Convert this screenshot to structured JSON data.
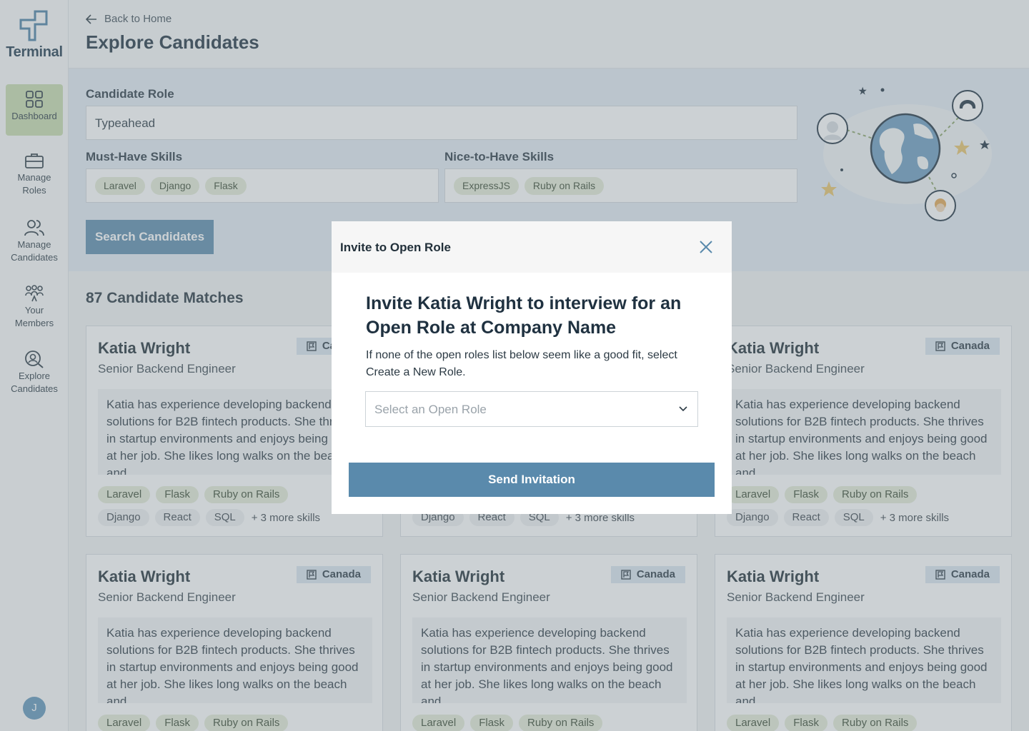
{
  "sidebar": {
    "brand": "Terminal",
    "items": [
      {
        "label": "Dashboard"
      },
      {
        "label": "Manage Roles"
      },
      {
        "label": "Manage Candidates"
      },
      {
        "label": "Your Members"
      },
      {
        "label": "Explore Candidates"
      }
    ],
    "avatar_initial": "J"
  },
  "header": {
    "back_label": "Back to Home",
    "title": "Explore Candidates"
  },
  "search": {
    "role_label": "Candidate Role",
    "role_value": "Typeahead",
    "must_label": "Must-Have Skills",
    "must_skills": [
      "Laravel",
      "Django",
      "Flask"
    ],
    "nice_label": "Nice-to-Have Skills",
    "nice_skills": [
      "ExpressJS",
      "Ruby on Rails"
    ],
    "button": "Search Candidates"
  },
  "results": {
    "title": "87 Candidate Matches",
    "card": {
      "name": "Katia Wright",
      "role": "Senior Backend Engineer",
      "location": "Canada",
      "bio": "Katia has experience developing backend solutions for B2B fintech products. She thrives in startup environments and enjoys being good at her job. She likes long walks on the beach and...",
      "skills_row1": [
        "Laravel",
        "Flask",
        "Ruby on Rails"
      ],
      "skills_row2": [
        "Django",
        "React",
        "SQL"
      ],
      "more_skills": "+ 3 more skills"
    }
  },
  "modal": {
    "title": "Invite to Open Role",
    "heading": "Invite Katia Wright to interview for an Open Role at Company Name",
    "description": "If none of the open roles list below seem like a good fit, select Create a New Role.",
    "select_placeholder": "Select an Open Role",
    "send_button": "Send Invitation"
  },
  "colors": {
    "accent": "#5a8aac",
    "chip_green": "#e5ecd7",
    "active_nav": "#c9ddae"
  }
}
